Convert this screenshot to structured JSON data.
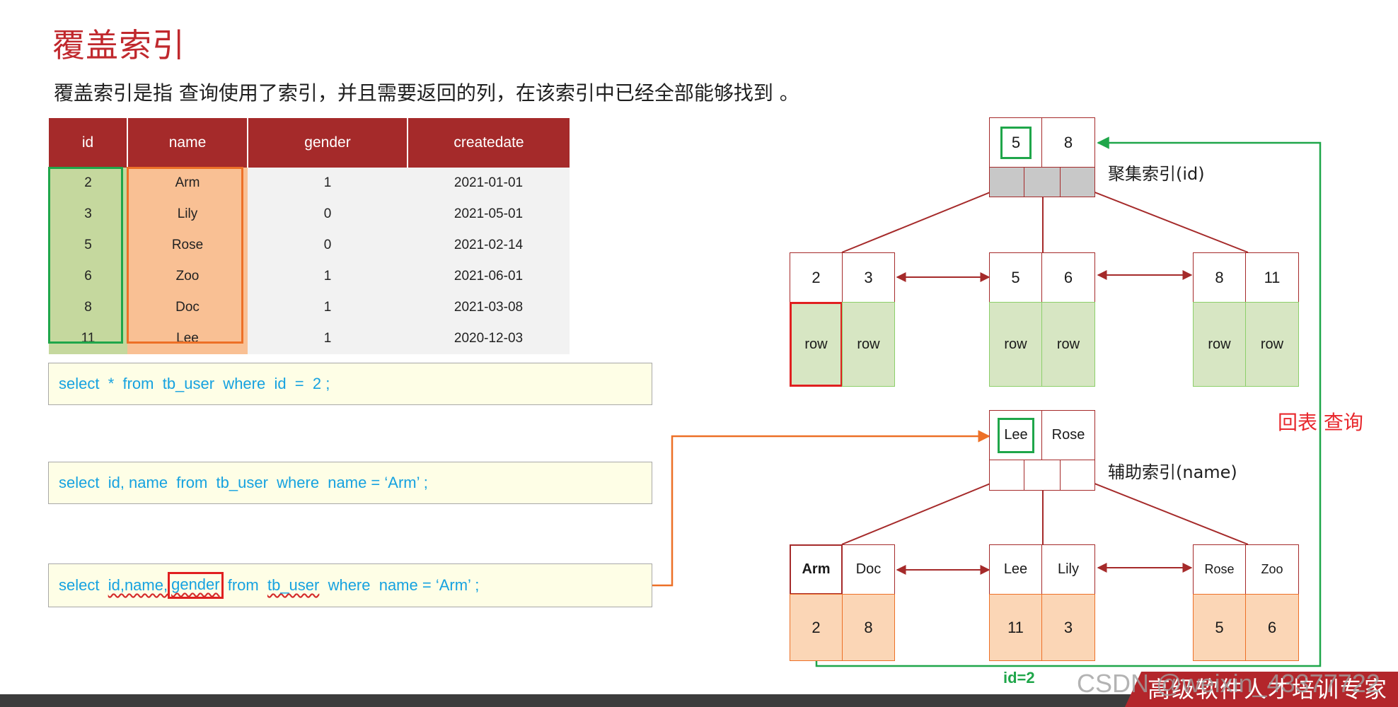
{
  "title": "覆盖索引",
  "subtitle": "覆盖索引是指 查询使用了索引，并且需要返回的列，在该索引中已经全部能够找到 。",
  "table": {
    "headers": [
      "id",
      "name",
      "gender",
      "createdate"
    ],
    "rows": [
      [
        "2",
        "Arm",
        "1",
        "2021-01-01"
      ],
      [
        "3",
        "Lily",
        "0",
        "2021-05-01"
      ],
      [
        "5",
        "Rose",
        "0",
        "2021-02-14"
      ],
      [
        "6",
        "Zoo",
        "1",
        "2021-06-01"
      ],
      [
        "8",
        "Doc",
        "1",
        "2021-03-08"
      ],
      [
        "11",
        "Lee",
        "1",
        "2020-12-03"
      ]
    ]
  },
  "sql": {
    "q1": "select  *  from  tb_user  where  id  =  2 ;",
    "q2": "select  id, name  from  tb_user  where  name = ‘Arm’ ;",
    "q3": {
      "p1": "select  ",
      "p2": "id,name,",
      "p3": "gender",
      "p4": " from  ",
      "p5": "tb_user",
      "p6": "  where  name = ‘Arm’ ;"
    }
  },
  "clustered": {
    "label": "聚集索引(id)",
    "root": [
      "5",
      "8"
    ],
    "leaves": [
      {
        "keys": [
          "2",
          "3"
        ],
        "rows": [
          "row",
          "row"
        ]
      },
      {
        "keys": [
          "5",
          "6"
        ],
        "rows": [
          "row",
          "row"
        ]
      },
      {
        "keys": [
          "8",
          "11"
        ],
        "rows": [
          "row",
          "row"
        ]
      }
    ]
  },
  "secondary": {
    "label": "辅助索引(name)",
    "root": [
      "Lee",
      "Rose"
    ],
    "leaves": [
      {
        "keys": [
          "Arm",
          "Doc"
        ],
        "values": [
          "2",
          "8"
        ]
      },
      {
        "keys": [
          "Lee",
          "Lily"
        ],
        "values": [
          "11",
          "3"
        ]
      },
      {
        "keys": [
          "Rose",
          "Zoo"
        ],
        "values": [
          "5",
          "6"
        ]
      }
    ]
  },
  "annotations": {
    "back_lookup": "回表 查询",
    "id_eq": "id=2"
  },
  "footer": {
    "watermark": "CSDN @weixin_43377722",
    "brand": "高级软件人才培训专家"
  },
  "colors": {
    "brand_red": "#a52a2a",
    "highlight_green": "#1fa64a",
    "highlight_orange": "#ed7027",
    "sql_blue": "#16a2e0"
  }
}
